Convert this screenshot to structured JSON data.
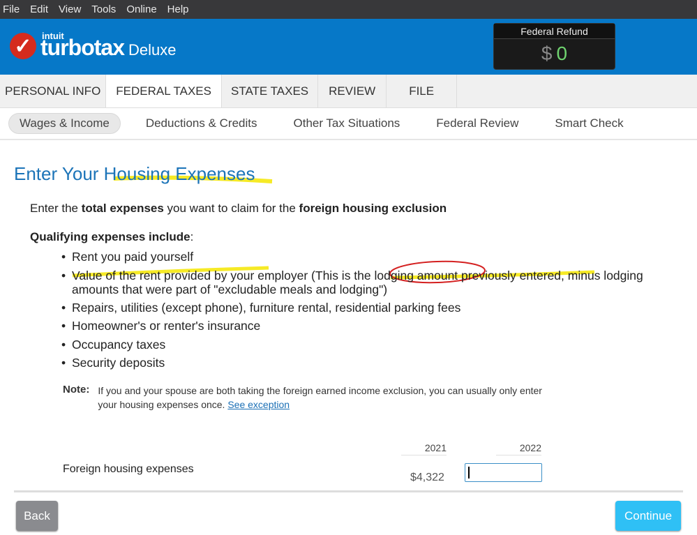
{
  "menu": [
    "File",
    "Edit",
    "View",
    "Tools",
    "Online",
    "Help"
  ],
  "brand": {
    "company": "intuit",
    "product": "turbotax",
    "edition": "Deluxe"
  },
  "refund": {
    "label": "Federal Refund",
    "currency": "$",
    "amount": "0"
  },
  "tabs": [
    {
      "label": "PERSONAL INFO"
    },
    {
      "label": "FEDERAL TAXES",
      "active": true
    },
    {
      "label": "STATE TAXES"
    },
    {
      "label": "REVIEW"
    },
    {
      "label": "FILE"
    }
  ],
  "subnav": [
    {
      "label": "Wages & Income",
      "active": true
    },
    {
      "label": "Deductions & Credits"
    },
    {
      "label": "Other Tax Situations"
    },
    {
      "label": "Federal Review"
    },
    {
      "label": "Smart Check"
    }
  ],
  "title": "Enter Your Housing Expenses",
  "intro": {
    "a": "Enter the ",
    "b": "total expenses",
    "c": " you want to claim for the ",
    "d": "foreign housing exclusion"
  },
  "qualifying": {
    "bold": "Qualifying expenses include",
    "colon": ":"
  },
  "bullets": [
    "Rent you paid yourself",
    "Value of the rent provided by your employer (This is the lodging amount previously entered, minus lodging amounts that were part of \"excludable meals and lodging\")",
    "Repairs, utilities (except phone), furniture rental, residential parking fees",
    "Homeowner's or renter's insurance",
    "Occupancy taxes",
    "Security deposits"
  ],
  "note": {
    "label": "Note:",
    "text": "If you and your spouse are both taking the foreign earned income exclusion, you can usually only enter your housing expenses once. ",
    "link": "See exception"
  },
  "table": {
    "years": [
      "2021",
      "2022"
    ],
    "row_label": "Foreign housing expenses",
    "prior_value": "$4,322",
    "current_value": ""
  },
  "buttons": {
    "back": "Back",
    "continue": "Continue"
  },
  "colors": {
    "header": "#0678c8",
    "title": "#1c74b8",
    "continue": "#2fc0f5",
    "highlight": "#f5e600",
    "annotation_circle": "#d42020"
  }
}
